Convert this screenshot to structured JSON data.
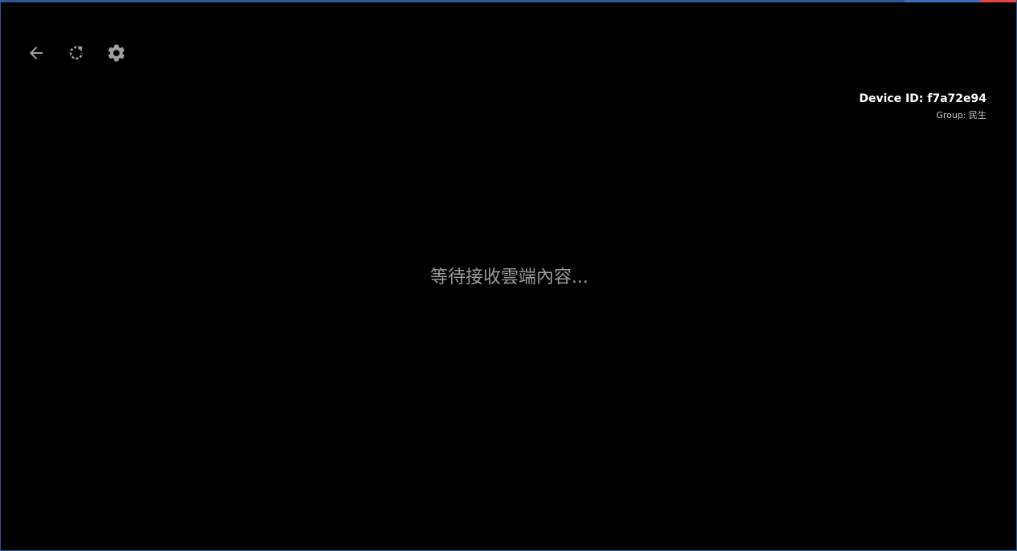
{
  "window": {
    "accent_color": "#2b5797",
    "close_accent_color": "#e04343",
    "background_color": "#000000"
  },
  "toolbar": {
    "items": [
      {
        "name": "back",
        "icon": "arrow-left-icon",
        "color": "#a0a0a0"
      },
      {
        "name": "refresh",
        "icon": "refresh-icon",
        "color": "#a0a0a0"
      },
      {
        "name": "settings",
        "icon": "gear-icon",
        "color": "#a0a0a0"
      }
    ]
  },
  "device": {
    "id_text": "Device ID: f7a72e94",
    "group_text": "Group: 民生"
  },
  "status": {
    "message": "等待接收雲端內容..."
  }
}
